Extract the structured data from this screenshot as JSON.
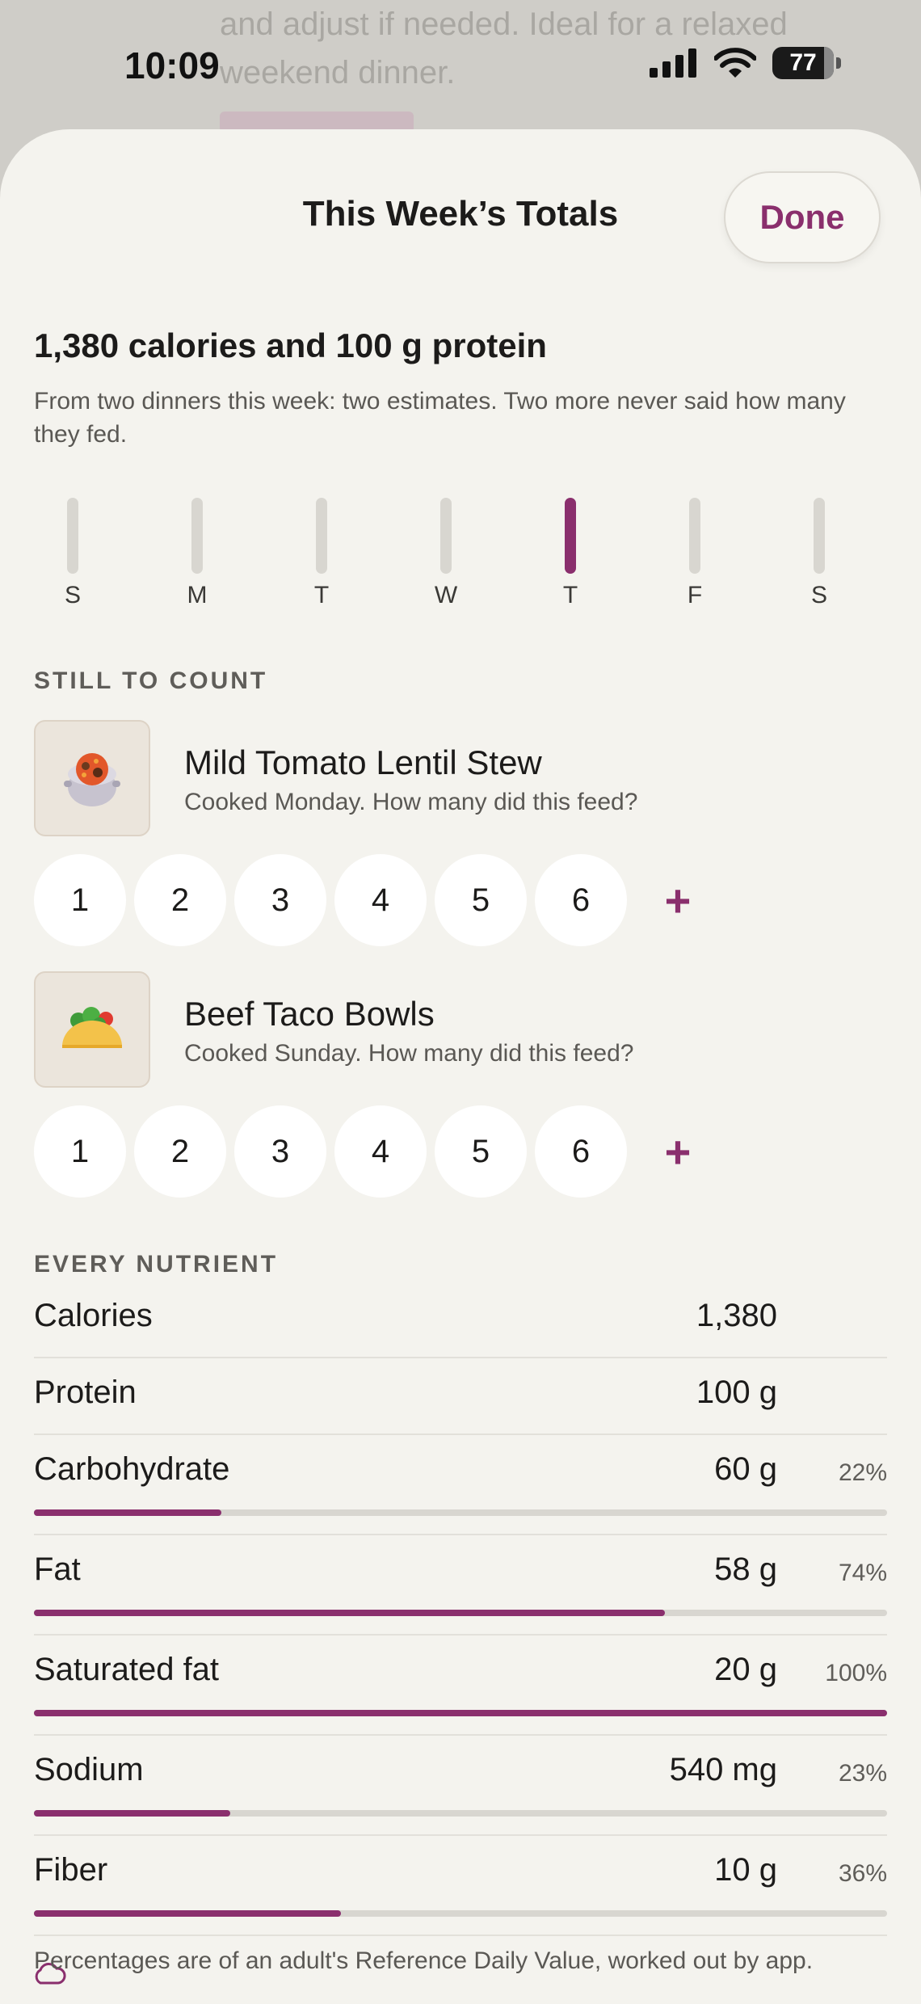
{
  "backdrop": {
    "line1": "and adjust if needed. Ideal for a relaxed",
    "line2": "weekend dinner."
  },
  "status_bar": {
    "time": "10:09",
    "battery": "77",
    "battery_level": 0.77
  },
  "sheet": {
    "title": "This Week’s Totals",
    "done_label": "Done",
    "headline": "1,380 calories and 100 g protein",
    "subtext": "From two dinners this week: two estimates. Two more never said how many they fed."
  },
  "week": {
    "days": [
      {
        "label": "S",
        "active": false
      },
      {
        "label": "M",
        "active": false
      },
      {
        "label": "T",
        "active": false
      },
      {
        "label": "W",
        "active": false
      },
      {
        "label": "T",
        "active": true
      },
      {
        "label": "F",
        "active": false
      },
      {
        "label": "S",
        "active": false
      }
    ],
    "accent": "#8a2f6d"
  },
  "still_to_count": {
    "label": "STILL TO COUNT",
    "recipes": [
      {
        "title": "Mild Tomato Lentil Stew",
        "subtitle": "Cooked Monday. How many did this feed?",
        "icon": "stew-pot-icon",
        "servings": [
          "1",
          "2",
          "3",
          "4",
          "5",
          "6"
        ],
        "add_label": "+"
      },
      {
        "title": "Beef Taco Bowls",
        "subtitle": "Cooked Sunday. How many did this feed?",
        "icon": "taco-icon",
        "servings": [
          "1",
          "2",
          "3",
          "4",
          "5",
          "6"
        ],
        "add_label": "+"
      }
    ]
  },
  "nutrients": {
    "label": "EVERY NUTRIENT",
    "rows": [
      {
        "name": "Calories",
        "value": "1,380",
        "percent": null,
        "fraction": null
      },
      {
        "name": "Protein",
        "value": "100 g",
        "percent": null,
        "fraction": null
      },
      {
        "name": "Carbohydrate",
        "value": "60 g",
        "percent": "22%",
        "fraction": 0.22
      },
      {
        "name": "Fat",
        "value": "58 g",
        "percent": "74%",
        "fraction": 0.74
      },
      {
        "name": "Saturated fat",
        "value": "20 g",
        "percent": "100%",
        "fraction": 1.0
      },
      {
        "name": "Sodium",
        "value": "540 mg",
        "percent": "23%",
        "fraction": 0.23
      },
      {
        "name": "Fiber",
        "value": "10 g",
        "percent": "36%",
        "fraction": 0.36
      }
    ],
    "footnote": "Percentages are of an adult's Reference Daily Value, worked out by app."
  }
}
